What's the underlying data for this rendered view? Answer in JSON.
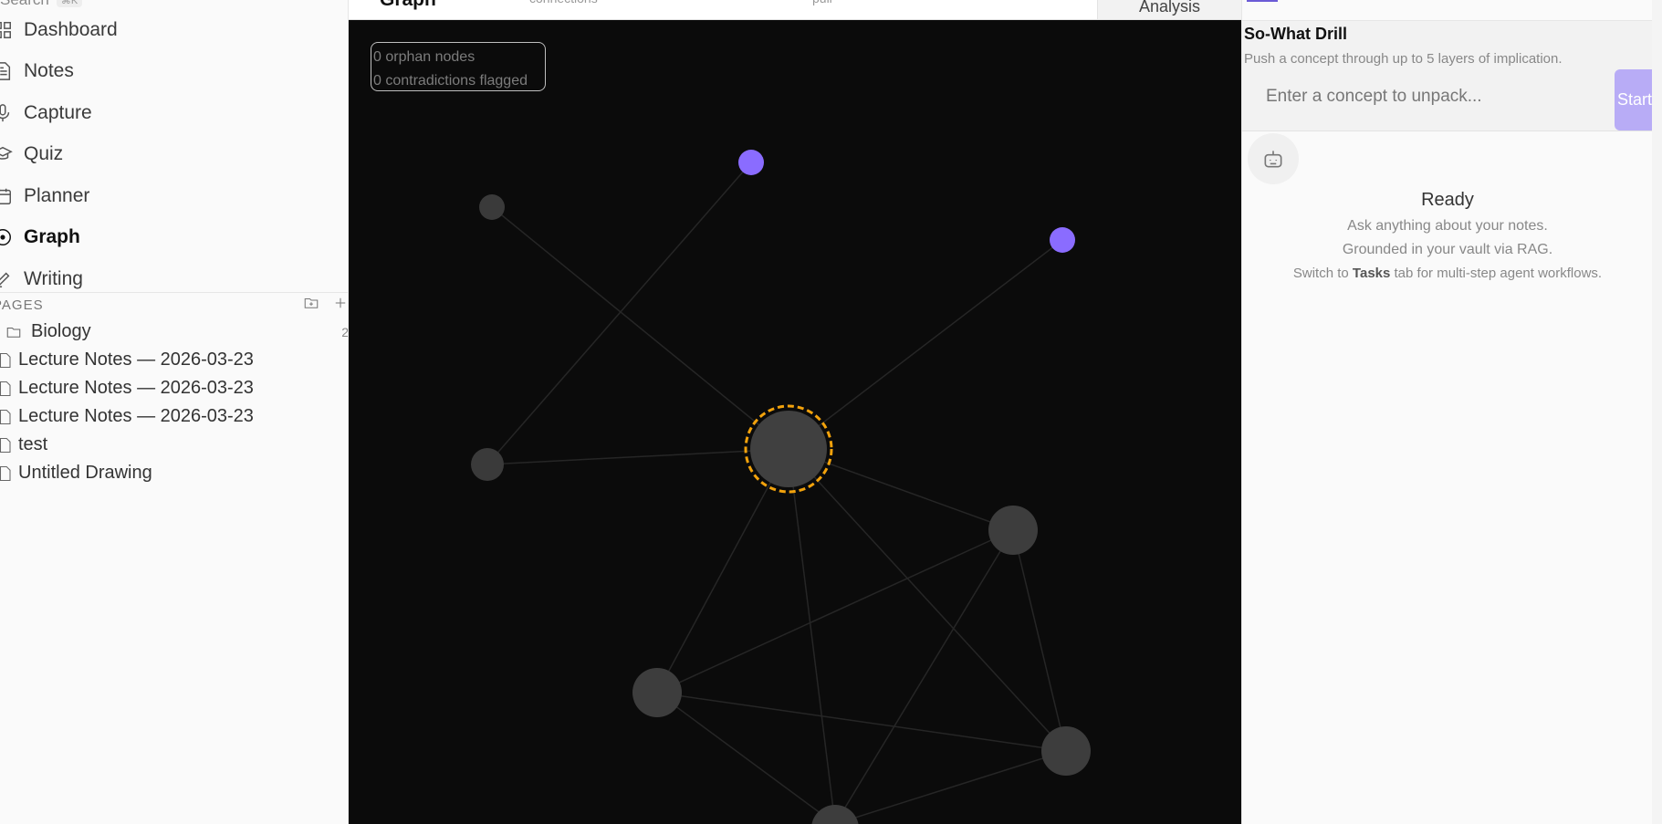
{
  "sidebar": {
    "search": {
      "label": "Search",
      "shortcut": "⌘K"
    },
    "nav": [
      {
        "label": "Dashboard",
        "icon": "grid-icon"
      },
      {
        "label": "Notes",
        "icon": "file-text-icon"
      },
      {
        "label": "Capture",
        "icon": "mic-icon"
      },
      {
        "label": "Quiz",
        "icon": "graduation-cap-icon"
      },
      {
        "label": "Planner",
        "icon": "calendar-icon"
      },
      {
        "label": "Graph",
        "icon": "graph-target-icon",
        "active": true
      },
      {
        "label": "Writing",
        "icon": "pencil-icon"
      }
    ],
    "pages_header": "PAGES",
    "tree": {
      "folder": {
        "label": "Biology",
        "count": "2"
      },
      "files": [
        "Lecture Notes — 2026-03-23",
        "Lecture Notes — 2026-03-23",
        "Lecture Notes — 2026-03-23",
        "test",
        "Untitled Drawing"
      ]
    }
  },
  "header": {
    "title": "Graph",
    "subtitle_left": "connections",
    "subtitle_mid": "pull",
    "analysis_tab": "Analysis"
  },
  "graph": {
    "stats": {
      "orphans": "0 orphan nodes",
      "contradictions": "0 contradictions flagged"
    },
    "colors": {
      "background": "#0b0b0b",
      "node": "#3d3d3d",
      "tag_node": "#8a6cff",
      "selected_ring": "#f2a20c",
      "edge": "#262626"
    }
  },
  "right_panel": {
    "drill": {
      "title": "So-What Drill",
      "description": "Push a concept through up to 5 layers of implication.",
      "input_placeholder": "Enter a concept to unpack...",
      "start_label": "Start"
    },
    "assistant": {
      "status": "Ready",
      "line1": "Ask anything about your notes.",
      "line2": "Grounded in your vault via RAG.",
      "line3_prefix": "Switch to ",
      "line3_bold": "Tasks",
      "line3_suffix": " tab for multi-step agent workflows."
    }
  }
}
